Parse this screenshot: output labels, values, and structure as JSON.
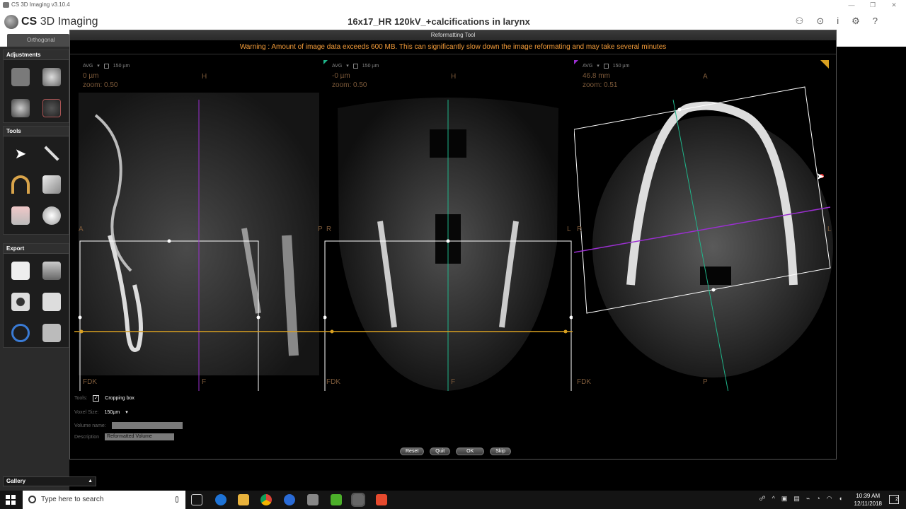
{
  "app": {
    "titlebar": "CS 3D Imaging v3.10.4",
    "brand_prefix": "CS",
    "brand_name": "3D Imaging",
    "study_title": "16x17_HR 120kV_+calcifications in larynx",
    "tab_ortho": "Orthogonal Slices"
  },
  "left_panel": {
    "adjustments_header": "Adjustments",
    "tools_header": "Tools",
    "export_header": "Export",
    "gallery_label": "Gallery"
  },
  "dialog": {
    "title": "Reformatting Tool",
    "warning": "Warning : Amount of image data exceeds 600 MB. This can significantly slow down the image reformating and may take several minutes",
    "views": [
      {
        "mode": "AVG",
        "thickness": "150 µm",
        "position": "0 µm",
        "zoom": "zoom: 0.50",
        "label_top": "H",
        "label_bottom": "F",
        "label_left": "A",
        "label_right": "P",
        "algo": "FDK"
      },
      {
        "mode": "AVG",
        "thickness": "150 µm",
        "position": "-0 µm",
        "zoom": "zoom: 0.50",
        "label_top": "H",
        "label_bottom": "F",
        "label_left": "R",
        "label_right": "L",
        "algo": "FDK"
      },
      {
        "mode": "AVG",
        "thickness": "150 µm",
        "position": "46.8 mm",
        "zoom": "zoom: 0.51",
        "label_top": "A",
        "label_bottom": "P",
        "label_left": "R",
        "label_right": "L",
        "algo": "FDK"
      }
    ],
    "controls": {
      "tools_label": "Tools:",
      "cropping_box_label": "Cropping box",
      "cropping_box_checked": "✓",
      "voxel_size_label": "Voxel Size:",
      "voxel_size_value": "150µm",
      "volume_name_label": "Volume name:",
      "volume_name_value": "",
      "description_label": "Description",
      "description_value": "Reformatted Volume"
    },
    "buttons": {
      "reset": "Reset",
      "quit": "Quit",
      "ok": "OK",
      "skip": "Skip"
    },
    "colors": {
      "warning": "#f29b39",
      "sagittal_line": "#9b2fd1",
      "coronal_line": "#1fb58a",
      "axial_line": "#d9a020"
    }
  },
  "taskbar": {
    "search_placeholder": "Type here to search",
    "time": "10:39 AM",
    "date": "12/11/2018",
    "notification_count": "2"
  }
}
